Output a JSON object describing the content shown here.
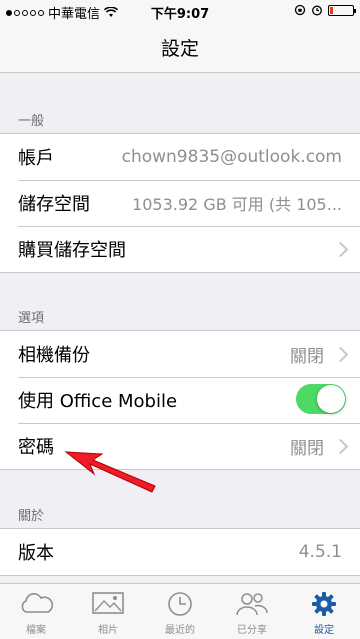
{
  "status": {
    "carrier": "中華電信",
    "time": "下午9:07"
  },
  "nav": {
    "title": "設定"
  },
  "general": {
    "header": "一般",
    "account_label": "帳戶",
    "account_value": "chown9835@outlook.com",
    "storage_label": "儲存空間",
    "storage_value": "1053.92 GB 可用 (共 105...",
    "buy_label": "購買儲存空間"
  },
  "options": {
    "header": "選項",
    "camera_label": "相機備份",
    "camera_value": "關閉",
    "office_label": "使用 Office Mobile",
    "office_on": true,
    "passcode_label": "密碼",
    "passcode_value": "關閉"
  },
  "about": {
    "header": "關於",
    "version_label": "版本",
    "version_value": "4.5.1"
  },
  "tabs": [
    {
      "label": "檔案",
      "icon": "cloud-icon"
    },
    {
      "label": "相片",
      "icon": "photo-icon"
    },
    {
      "label": "最近的",
      "icon": "clock-icon"
    },
    {
      "label": "已分享",
      "icon": "people-icon"
    },
    {
      "label": "設定",
      "icon": "gear-icon",
      "active": true
    }
  ],
  "colors": {
    "toggle_on": "#4cd964",
    "accent": "#1a5da6",
    "arrow": "#ee1c25"
  }
}
